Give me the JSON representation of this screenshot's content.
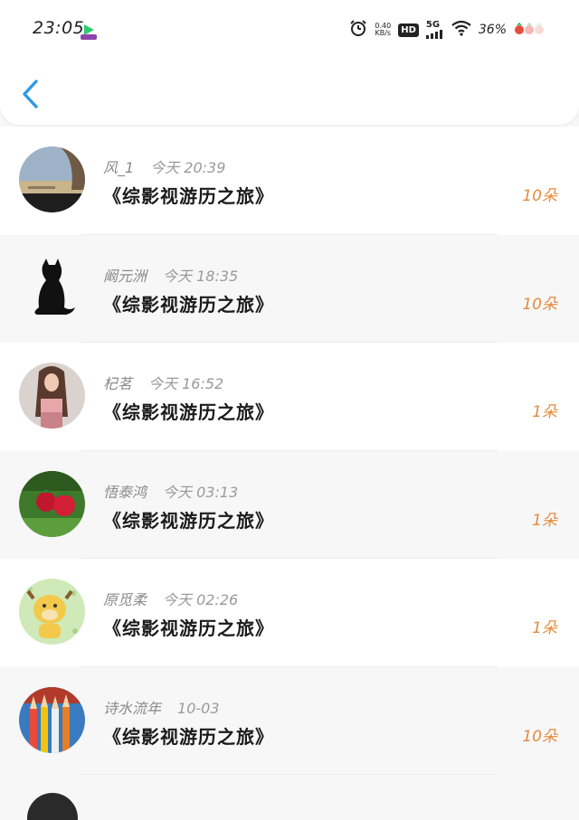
{
  "status_bar": {
    "time": "23:05",
    "net_speed_value": "0.40",
    "net_speed_unit": "KB/s",
    "hd": "HD",
    "network": "5G",
    "battery": "36%"
  },
  "header": {
    "back_icon": "chevron-left-icon"
  },
  "colors": {
    "accent": "#2f9be3",
    "count": "#e58a3b"
  },
  "items": [
    {
      "name": "风_1",
      "time": "今天 20:39",
      "title": "《综影视游历之旅》",
      "count": "10朵",
      "avatar": "landscape"
    },
    {
      "name": "阚元洲",
      "time": "今天 18:35",
      "title": "《综影视游历之旅》",
      "count": "10朵",
      "avatar": "black-cat"
    },
    {
      "name": "杞茗",
      "time": "今天 16:52",
      "title": "《综影视游历之旅》",
      "count": "1朵",
      "avatar": "girl-photo"
    },
    {
      "name": "悟泰鸿",
      "time": "今天 03:13",
      "title": "《综影视游历之旅》",
      "count": "1朵",
      "avatar": "strawberries"
    },
    {
      "name": "原觅柔",
      "time": "今天 02:26",
      "title": "《综影视游历之旅》",
      "count": "1朵",
      "avatar": "cartoon-cow"
    },
    {
      "name": "诗水流年",
      "time": "10-03",
      "title": "《综影视游历之旅》",
      "count": "10朵",
      "avatar": "pencils"
    }
  ]
}
